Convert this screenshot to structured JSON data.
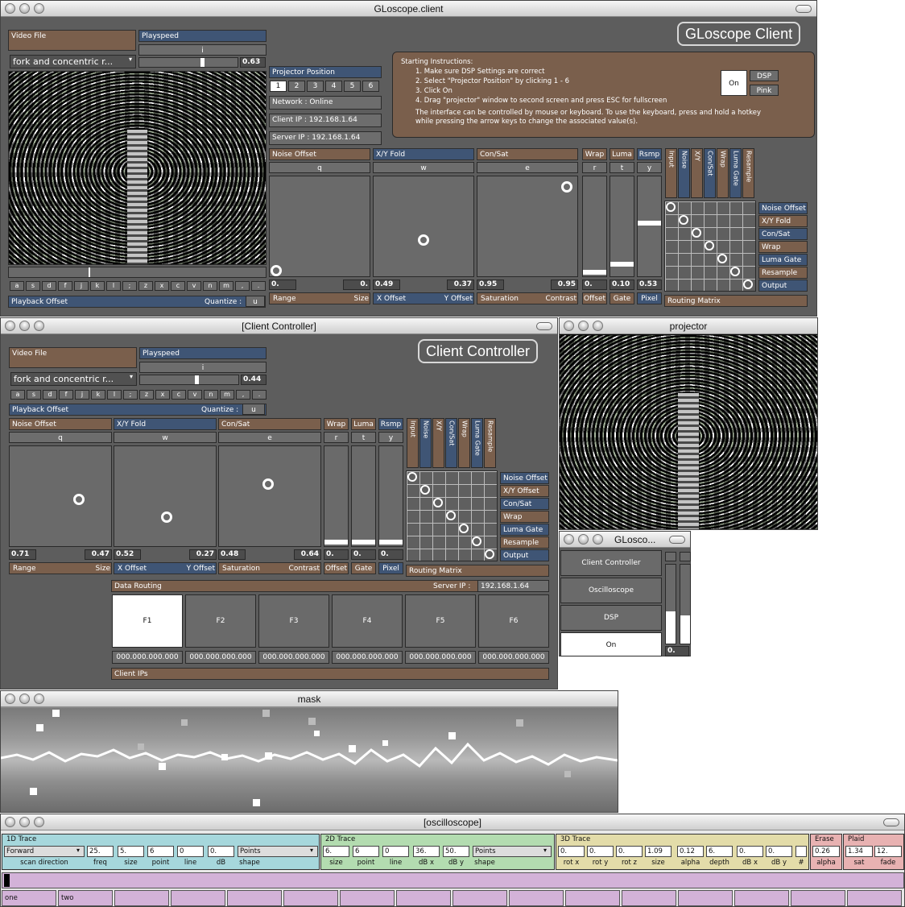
{
  "client": {
    "title": "GLoscope.client",
    "heading": "GLoscope Client",
    "video_file_label": "Video File",
    "video_file_value": "fork and concentric r...",
    "playspeed_label": "Playspeed",
    "playspeed_key": "i",
    "playspeed_value": "0.63",
    "projector_position_label": "Projector Position",
    "positions": [
      "1",
      "2",
      "3",
      "4",
      "5",
      "6"
    ],
    "network_status": "Network : Online",
    "client_ip": "Client IP : 192.168.1.64",
    "server_ip": "Server IP : 192.168.1.64",
    "instructions_title": "Starting Instructions:",
    "instructions": [
      "1. Make sure DSP Settings are correct",
      "2. Select \"Projector Position\" by clicking 1 - 6",
      "3. Click On",
      "4. Drag \"projector\" window to second screen and press ESC for fullscreen"
    ],
    "instructions_note": "The interface can be controlled by mouse or keyboard. To use the keyboard, press and hold a hotkey while pressing the arrow keys to change the associated value(s).",
    "on_label": "On",
    "dsp_label": "DSP",
    "pink_label": "Pink",
    "keys": [
      "a",
      "s",
      "d",
      "f",
      "j",
      "k",
      "l",
      ";",
      "z",
      "x",
      "c",
      "v",
      "n",
      "m",
      ",",
      "."
    ],
    "playback_offset_label": "Playback Offset",
    "quantize_label": "Quantize :",
    "quantize_key": "u",
    "pads": [
      {
        "title": "Noise Offset",
        "key": "q",
        "a": "0.",
        "b": "0.",
        "left": "Range",
        "right": "Size"
      },
      {
        "title": "X/Y Fold",
        "key": "w",
        "a": "0.49",
        "b": "0.37",
        "left": "X Offset",
        "right": "Y Offset"
      },
      {
        "title": "Con/Sat",
        "key": "e",
        "a": "0.95",
        "b": "0.95",
        "left": "Saturation",
        "right": "Contrast"
      }
    ],
    "sliders": [
      {
        "title": "Wrap",
        "key": "r",
        "value": "0.",
        "foot": "Offset"
      },
      {
        "title": "Luma",
        "key": "t",
        "value": "0.10",
        "foot": "Gate"
      },
      {
        "title": "Rsmp",
        "key": "y",
        "value": "0.53",
        "foot": "Pixel"
      }
    ],
    "routing_label": "Routing Matrix",
    "routing_cols": [
      "Input",
      "Noise",
      "X/Y",
      "Con/Sat",
      "Wrap",
      "Luma Gate",
      "Resample"
    ],
    "routing_rows": [
      "Noise Offset",
      "X/Y Fold",
      "Con/Sat",
      "Wrap",
      "Luma Gate",
      "Resample",
      "Output"
    ]
  },
  "controller": {
    "title": "[Client Controller]",
    "heading": "Client Controller",
    "video_file_label": "Video File",
    "video_file_value": "fork and concentric r...",
    "playspeed_label": "Playspeed",
    "playspeed_key": "i",
    "playspeed_value": "0.44",
    "keys": [
      "a",
      "s",
      "d",
      "f",
      "j",
      "k",
      "l",
      ";",
      "z",
      "x",
      "c",
      "v",
      "n",
      "m",
      ",",
      "."
    ],
    "playback_offset_label": "Playback Offset",
    "quantize_label": "Quantize :",
    "quantize_key": "u",
    "pads": [
      {
        "title": "Noise Offset",
        "key": "q",
        "a": "0.71",
        "b": "0.47",
        "left": "Range",
        "right": "Size"
      },
      {
        "title": "X/Y Fold",
        "key": "w",
        "a": "0.52",
        "b": "0.27",
        "left": "X Offset",
        "right": "Y Offset"
      },
      {
        "title": "Con/Sat",
        "key": "e",
        "a": "0.48",
        "b": "0.64",
        "left": "Saturation",
        "right": "Contrast"
      }
    ],
    "sliders": [
      {
        "title": "Wrap",
        "key": "r",
        "value": "0.",
        "foot": "Offset"
      },
      {
        "title": "Luma",
        "key": "t",
        "value": "0.",
        "foot": "Gate"
      },
      {
        "title": "Rsmp",
        "key": "y",
        "value": "0.",
        "foot": "Pixel"
      }
    ],
    "routing_label": "Routing Matrix",
    "routing_cols": [
      "Input",
      "Noise",
      "X/Y",
      "Con/Sat",
      "Wrap",
      "Luma Gate",
      "Resample"
    ],
    "routing_rows": [
      "Noise Offset",
      "X/Y Offset",
      "Con/Sat",
      "Wrap",
      "Luma Gate",
      "Resample",
      "Output"
    ],
    "data_routing_label": "Data Routing",
    "server_ip_label": "Server IP :",
    "server_ip_value": "192.168.1.64",
    "fkeys": [
      "F1",
      "F2",
      "F3",
      "F4",
      "F5",
      "F6"
    ],
    "client_ip_values": [
      "000.000.000.000",
      "000.000.000.000",
      "000.000.000.000",
      "000.000.000.000",
      "000.000.000.000",
      "000.000.000.000"
    ],
    "client_ips_label": "Client IPs"
  },
  "projector": {
    "title": "projector"
  },
  "gloscope": {
    "title": "GLosco...",
    "buttons": [
      "Client Controller",
      "Oscilloscope",
      "DSP",
      "On"
    ],
    "meter_value": "0."
  },
  "mask": {
    "title": "mask"
  },
  "oscilloscope": {
    "title": "[oscilloscope]",
    "trace1": {
      "label": "1D Trace",
      "direction": "Forward",
      "freq": "25.",
      "size": "5.",
      "point": "6",
      "line": "0",
      "db": "0.",
      "shape": "Points",
      "labels": [
        "scan direction",
        "freq",
        "size",
        "point",
        "line",
        "dB",
        "shape"
      ]
    },
    "trace2": {
      "label": "2D Trace",
      "size": "6.",
      "point": "6",
      "line": "0",
      "dbx": "36.",
      "dby": "50.",
      "shape": "Points",
      "labels": [
        "size",
        "point",
        "line",
        "dB x",
        "dB y",
        "shape"
      ]
    },
    "trace3": {
      "label": "3D Trace",
      "rotx": "0.",
      "roty": "0.",
      "rotz": "0.",
      "size": "1.09",
      "alpha": "0.12",
      "depth": "6.",
      "dbx": "0.",
      "dby": "0.",
      "labels": [
        "rot x",
        "rot y",
        "rot z",
        "size",
        "alpha",
        "depth",
        "dB x",
        "dB y",
        "#"
      ]
    },
    "erase": {
      "label": "Erase",
      "alpha": "0.26",
      "alpha_label": "alpha"
    },
    "plaid": {
      "label": "Plaid",
      "sat": "1.34",
      "fade": "12.",
      "sat_label": "sat",
      "fade_label": "fade"
    },
    "bottom_labels": [
      "one",
      "two"
    ]
  },
  "colors": {
    "brown": "#7a5f4c",
    "blue": "#3f5575",
    "panel": "#5d5d5d",
    "osc_cyan": "#a6d7dc",
    "osc_green": "#b3dcb0",
    "osc_yellow": "#e3dca9",
    "osc_pink": "#e8b2b2",
    "osc_violet": "#d3b2d8"
  }
}
